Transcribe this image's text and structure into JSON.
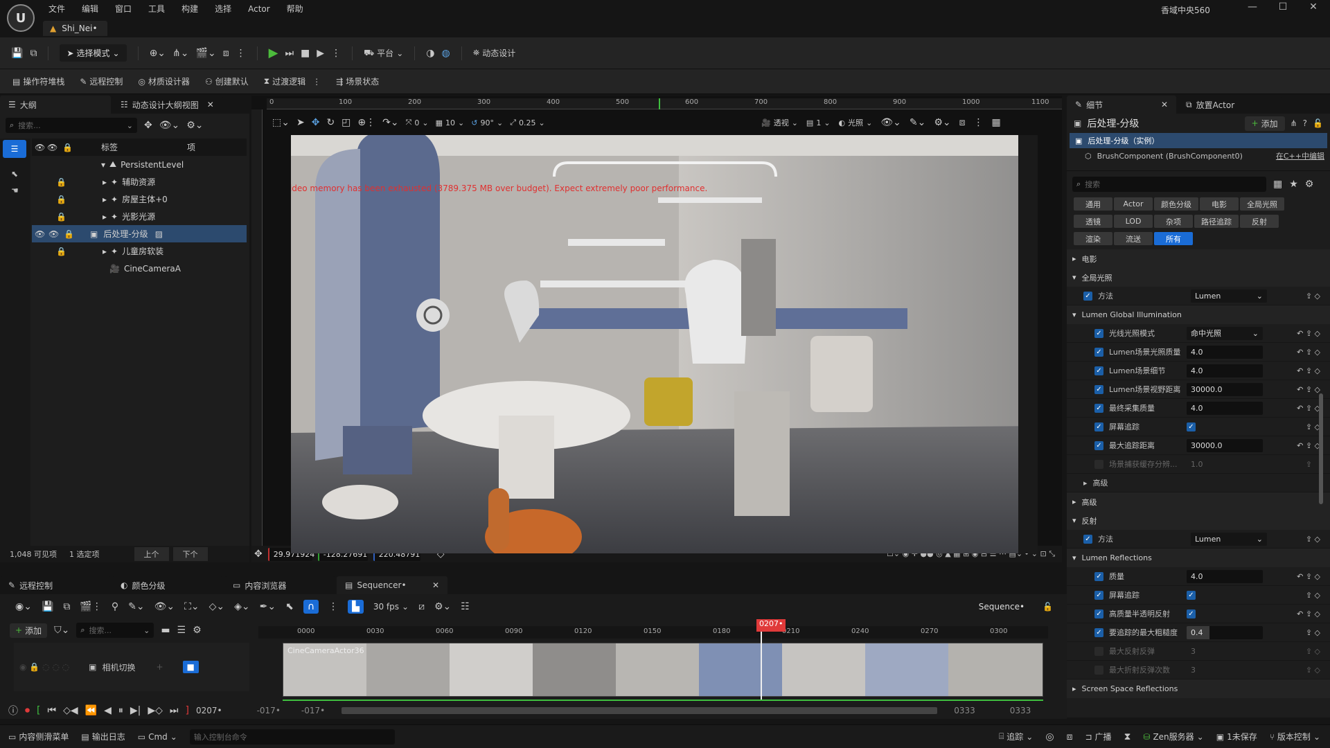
{
  "app": {
    "menu": [
      "文件",
      "编辑",
      "窗口",
      "工具",
      "构建",
      "选择",
      "Actor",
      "帮助"
    ],
    "doc_tab": "Shi_Nei•",
    "window_title_right": "香域中央560"
  },
  "toolbar1": {
    "mode": "选择模式",
    "platform": "平台",
    "motion_design": "动态设计"
  },
  "toolbar2": {
    "items": [
      "操作符堆栈",
      "远程控制",
      "材质设计器",
      "创建默认",
      "过渡逻辑",
      "场景状态"
    ]
  },
  "outliner": {
    "tabs": [
      "大纲",
      "动态设计大纲视图"
    ],
    "search_placeholder": "搜索...",
    "col_label": "标签",
    "col_type": "项",
    "root": "PersistentLevel",
    "items": [
      "辅助资源",
      "房屋主体+0",
      "光影光源",
      "后处理-分级",
      "儿童房软装",
      "CineCameraA"
    ],
    "footer_count": "1,048 可见项",
    "footer_selected": "1 选定项",
    "prev": "上个",
    "next": "下个"
  },
  "viewport": {
    "ruler_top": [
      "0",
      "100",
      "200",
      "300",
      "400",
      "500",
      "600",
      "700",
      "800",
      "900",
      "1000",
      "1100"
    ],
    "snap_angle": "0",
    "grid": "10",
    "rot": "90°",
    "scale": "0.25",
    "perspective": "透视",
    "cam_speed": "1",
    "lighting": "光照",
    "warning": "Video memory has been exhausted (3789.375 MB over budget). Expect extremely poor performance.",
    "coord_x": "29.971924",
    "coord_y": "-128.27691",
    "coord_z": "220.48791"
  },
  "details": {
    "tabs": [
      "细节",
      "放置Actor"
    ],
    "title": "后处理-分级",
    "add": "添加",
    "instance": "后处理-分级（实例）",
    "component": "BrushComponent (BrushComponent0)",
    "edit_cpp": "在C++中编辑",
    "search_placeholder": "搜索",
    "chips": [
      [
        "通用",
        "Actor",
        "颜色分级",
        "电影",
        "全局光照"
      ],
      [
        "透镜",
        "LOD",
        "杂项",
        "路径追踪",
        "反射"
      ],
      [
        "渲染",
        "流送",
        "所有"
      ]
    ],
    "cat_film": "电影",
    "cat_gi": "全局光照",
    "method_label": "方法",
    "method_value": "Lumen",
    "lumen_gi": "Lumen Global Illumination",
    "gi_rows": [
      {
        "label": "光线光照模式",
        "value": "命中光照"
      },
      {
        "label": "Lumen场景光照质量",
        "value": "4.0"
      },
      {
        "label": "Lumen场景细节",
        "value": "4.0"
      },
      {
        "label": "Lumen场景视野距离",
        "value": "30000.0"
      },
      {
        "label": "最终采集质量",
        "value": "4.0"
      },
      {
        "label": "屏幕追踪",
        "value": ""
      },
      {
        "label": "最大追踪距离",
        "value": "30000.0"
      },
      {
        "label": "场景捕获缓存分辨...",
        "value": "1.0"
      }
    ],
    "advanced": "高级",
    "cat_advanced": "高级",
    "cat_reflection": "反射",
    "refl_method_value": "Lumen",
    "lumen_refl": "Lumen Reflections",
    "refl_rows": [
      {
        "label": "质量",
        "value": "4.0"
      },
      {
        "label": "屏幕追踪",
        "value": ""
      },
      {
        "label": "高质量半透明反射",
        "value": ""
      },
      {
        "label": "要追踪的最大粗糙度",
        "value": "0.4"
      },
      {
        "label": "最大反射反弹",
        "value": "3"
      },
      {
        "label": "最大折射反弹次数",
        "value": "3"
      }
    ],
    "ssr": "Screen Space Reflections"
  },
  "bottom": {
    "tabs": [
      "远程控制",
      "颜色分级",
      "内容浏览器",
      "Sequencer•"
    ],
    "fps": "30 fps",
    "seq_name": "Sequence•",
    "add": "添加",
    "search_placeholder": "搜索...",
    "track": "相机切换",
    "playhead": "0207•",
    "ruler": [
      "0000",
      "0030",
      "0060",
      "0090",
      "0120",
      "0150",
      "0180",
      "0210",
      "0240",
      "0270",
      "0300"
    ],
    "shot_name": "CineCameraActor36",
    "current_frame": "0207•",
    "start1": "-017•",
    "start2": "-017•",
    "end1": "0333",
    "end2": "0333"
  },
  "status": {
    "content_drawer": "内容侧滑菜单",
    "output_log": "输出日志",
    "cmd": "Cmd",
    "cmd_placeholder": "输入控制台命令",
    "trace": "追踪",
    "broadcast": "广播",
    "zen": "Zen服务器",
    "unsaved": "1未保存",
    "version": "版本控制"
  }
}
